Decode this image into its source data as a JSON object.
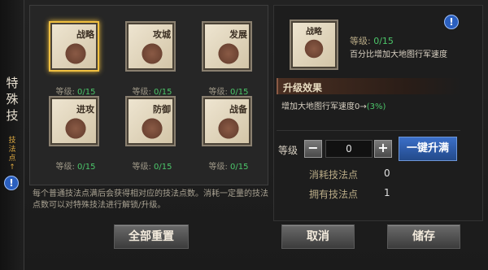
{
  "side_tab": {
    "title": "特殊技",
    "subtitle": "技法点↑"
  },
  "skills": [
    {
      "name": "战略",
      "level_label": "等级:",
      "level_value": "0/15"
    },
    {
      "name": "攻城",
      "level_label": "等级:",
      "level_value": "0/15"
    },
    {
      "name": "发展",
      "level_label": "等级:",
      "level_value": "0/15"
    },
    {
      "name": "进攻",
      "level_label": "等级:",
      "level_value": "0/15"
    },
    {
      "name": "防御",
      "level_label": "等级:",
      "level_value": "0/15"
    },
    {
      "name": "战备",
      "level_label": "等级:",
      "level_value": "0/15"
    }
  ],
  "description": "每个普通技法点满后会获得相对应的技法点数。消耗一定量的技法点数可以对特殊技法进行解锁/升级。",
  "buttons": {
    "reset": "全部重置",
    "cancel": "取消",
    "save": "储存",
    "max": "一键升满"
  },
  "detail": {
    "skill_name": "战略",
    "level_label": "等级:",
    "level_value": "0/15",
    "effect": "百分比增加大地图行军速度",
    "upgrade_title": "升级效果",
    "upgrade_text": "增加大地图行军速度0→",
    "upgrade_value": "(3%)",
    "level_input_label": "等级",
    "level_input_value": "0",
    "consume_label": "消耗技法点",
    "consume_value": "0",
    "own_label": "拥有技法点",
    "own_value": "1"
  },
  "colors": {
    "accent_blue": "#2a5fbf",
    "green": "#4cc66a",
    "gold": "#f0c040"
  }
}
